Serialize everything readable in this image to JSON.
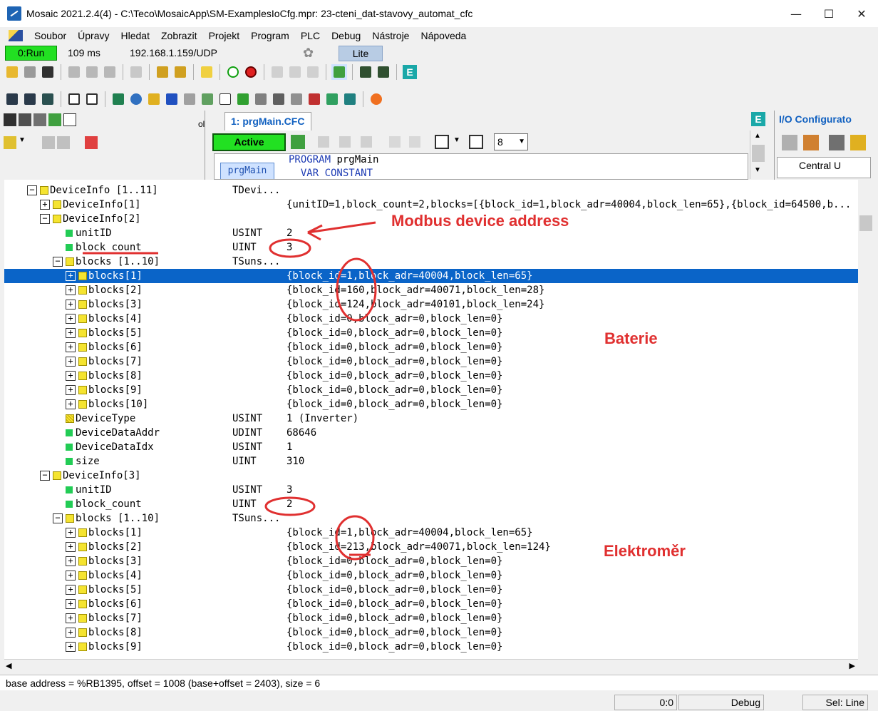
{
  "window": {
    "title": "Mosaic 2021.2.4(4) - C:\\Teco\\MosaicApp\\SM-ExamplesIoCfg.mpr: 23-cteni_dat-stavovy_automat_cfc",
    "minimize": "—",
    "maximize": "☐",
    "close": "✕"
  },
  "menu": [
    "Soubor",
    "Úpravy",
    "Hledat",
    "Zobrazit",
    "Projekt",
    "Program",
    "PLC",
    "Debug",
    "Nástroje",
    "Nápoveda"
  ],
  "status": {
    "run": "0:Run",
    "cycle": "109 ms",
    "ip": "192.168.1.159/UDP",
    "edition": "Lite"
  },
  "editor": {
    "tab": "1: prgMain.CFC",
    "active": "Active",
    "zoom": "8",
    "pgm_label": "prgMain",
    "code": [
      {
        "kw": "PROGRAM",
        "id": "prgMain"
      },
      {
        "kw": "  VAR CONSTANT",
        "id": ""
      }
    ],
    "left_tab_fragment": "ol"
  },
  "io": {
    "title": "I/O Configurato",
    "tree_item": "Central U"
  },
  "watch_rows": [
    {
      "indent": 0,
      "expander": "−",
      "icon": "yellow",
      "name": "DeviceInfo [1..11]",
      "type": "TDevi...",
      "value": ""
    },
    {
      "indent": 1,
      "expander": "+",
      "icon": "yellow",
      "name": "DeviceInfo[1]",
      "type": "",
      "value": "{unitID=1,block_count=2,blocks=[{block_id=1,block_adr=40004,block_len=65},{block_id=64500,b..."
    },
    {
      "indent": 1,
      "expander": "−",
      "icon": "yellow",
      "name": "DeviceInfo[2]",
      "type": "",
      "value": ""
    },
    {
      "indent": 2,
      "expander": "",
      "icon": "green",
      "name": "unitID",
      "type": "USINT",
      "value": "2"
    },
    {
      "indent": 2,
      "expander": "",
      "icon": "green",
      "name": "block_count",
      "type": "UINT",
      "value": "3"
    },
    {
      "indent": 2,
      "expander": "−",
      "icon": "yellow",
      "name": "blocks [1..10]",
      "type": "TSuns...",
      "value": ""
    },
    {
      "indent": 3,
      "expander": "+",
      "icon": "yellow",
      "name": "blocks[1]",
      "type": "",
      "value": "{block_id=1,block_adr=40004,block_len=65}",
      "selected": true
    },
    {
      "indent": 3,
      "expander": "+",
      "icon": "yellow",
      "name": "blocks[2]",
      "type": "",
      "value": "{block_id=160,block_adr=40071,block_len=28}"
    },
    {
      "indent": 3,
      "expander": "+",
      "icon": "yellow",
      "name": "blocks[3]",
      "type": "",
      "value": "{block_id=124,block_adr=40101,block_len=24}"
    },
    {
      "indent": 3,
      "expander": "+",
      "icon": "yellow",
      "name": "blocks[4]",
      "type": "",
      "value": "{block_id=0,block_adr=0,block_len=0}"
    },
    {
      "indent": 3,
      "expander": "+",
      "icon": "yellow",
      "name": "blocks[5]",
      "type": "",
      "value": "{block_id=0,block_adr=0,block_len=0}"
    },
    {
      "indent": 3,
      "expander": "+",
      "icon": "yellow",
      "name": "blocks[6]",
      "type": "",
      "value": "{block_id=0,block_adr=0,block_len=0}"
    },
    {
      "indent": 3,
      "expander": "+",
      "icon": "yellow",
      "name": "blocks[7]",
      "type": "",
      "value": "{block_id=0,block_adr=0,block_len=0}"
    },
    {
      "indent": 3,
      "expander": "+",
      "icon": "yellow",
      "name": "blocks[8]",
      "type": "",
      "value": "{block_id=0,block_adr=0,block_len=0}"
    },
    {
      "indent": 3,
      "expander": "+",
      "icon": "yellow",
      "name": "blocks[9]",
      "type": "",
      "value": "{block_id=0,block_adr=0,block_len=0}"
    },
    {
      "indent": 3,
      "expander": "+",
      "icon": "yellow",
      "name": "blocks[10]",
      "type": "",
      "value": "{block_id=0,block_adr=0,block_len=0}"
    },
    {
      "indent": 2,
      "expander": "",
      "icon": "hatch",
      "name": "DeviceType",
      "type": "USINT",
      "value": "1 (Inverter)"
    },
    {
      "indent": 2,
      "expander": "",
      "icon": "green",
      "name": "DeviceDataAddr",
      "type": "UDINT",
      "value": "68646"
    },
    {
      "indent": 2,
      "expander": "",
      "icon": "green",
      "name": "DeviceDataIdx",
      "type": "USINT",
      "value": "1"
    },
    {
      "indent": 2,
      "expander": "",
      "icon": "green",
      "name": "size",
      "type": "UINT",
      "value": "310"
    },
    {
      "indent": 1,
      "expander": "−",
      "icon": "yellow",
      "name": "DeviceInfo[3]",
      "type": "",
      "value": ""
    },
    {
      "indent": 2,
      "expander": "",
      "icon": "green",
      "name": "unitID",
      "type": "USINT",
      "value": "3"
    },
    {
      "indent": 2,
      "expander": "",
      "icon": "green",
      "name": "block_count",
      "type": "UINT",
      "value": "2"
    },
    {
      "indent": 2,
      "expander": "−",
      "icon": "yellow",
      "name": "blocks [1..10]",
      "type": "TSuns...",
      "value": ""
    },
    {
      "indent": 3,
      "expander": "+",
      "icon": "yellow",
      "name": "blocks[1]",
      "type": "",
      "value": "{block_id=1,block_adr=40004,block_len=65}"
    },
    {
      "indent": 3,
      "expander": "+",
      "icon": "yellow",
      "name": "blocks[2]",
      "type": "",
      "value": "{block_id=213,block_adr=40071,block_len=124}"
    },
    {
      "indent": 3,
      "expander": "+",
      "icon": "yellow",
      "name": "blocks[3]",
      "type": "",
      "value": "{block_id=0,block_adr=0,block_len=0}"
    },
    {
      "indent": 3,
      "expander": "+",
      "icon": "yellow",
      "name": "blocks[4]",
      "type": "",
      "value": "{block_id=0,block_adr=0,block_len=0}"
    },
    {
      "indent": 3,
      "expander": "+",
      "icon": "yellow",
      "name": "blocks[5]",
      "type": "",
      "value": "{block_id=0,block_adr=0,block_len=0}"
    },
    {
      "indent": 3,
      "expander": "+",
      "icon": "yellow",
      "name": "blocks[6]",
      "type": "",
      "value": "{block_id=0,block_adr=0,block_len=0}"
    },
    {
      "indent": 3,
      "expander": "+",
      "icon": "yellow",
      "name": "blocks[7]",
      "type": "",
      "value": "{block_id=0,block_adr=0,block_len=0}"
    },
    {
      "indent": 3,
      "expander": "+",
      "icon": "yellow",
      "name": "blocks[8]",
      "type": "",
      "value": "{block_id=0,block_adr=0,block_len=0}"
    },
    {
      "indent": 3,
      "expander": "+",
      "icon": "yellow",
      "name": "blocks[9]",
      "type": "",
      "value": "{block_id=0,block_adr=0,block_len=0}"
    }
  ],
  "annotations": {
    "modbus": "Modbus device address",
    "battery": "Baterie",
    "meter": "Elektroměr"
  },
  "status_line": "base address = %RB1395, offset = 1008 (base+offset = 2403), size = 6",
  "statusbar": {
    "pos": "0:0",
    "mode": "Debug",
    "sel": "Sel: Line"
  },
  "colors": {
    "run_green": "#22e022",
    "selection": "#0a64c8",
    "annotation": "#e03030",
    "tab_blue": "#1060c0"
  }
}
